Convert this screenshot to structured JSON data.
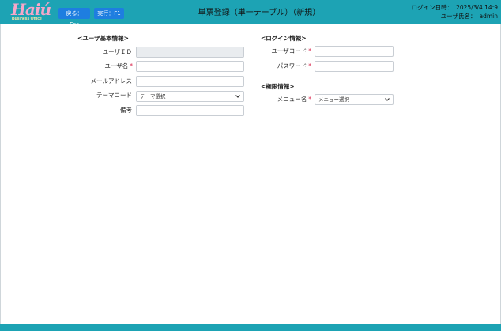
{
  "header": {
    "logo_main": "Haiú",
    "logo_sub": "Business Office",
    "back_button": "戻る：Esc",
    "run_button": "実行：F1",
    "title": "単票登録（単一テーブル）（新規）",
    "login_time_label": "ログイン日時：",
    "login_time_value": "2025/3/4 14:9",
    "user_name_label": "ユーザ氏名：",
    "user_name_value": "admin"
  },
  "user_info": {
    "section_title": "<ユーザ基本情報>",
    "user_id_label": "ユーザＩＤ",
    "user_name_label": "ユーザ名",
    "email_label": "メールアドレス",
    "theme_label": "テーマコード",
    "theme_selected": "テーマ選択",
    "note_label": "備考"
  },
  "login_info": {
    "section_title": "<ログイン情報>",
    "user_code_label": "ユーザコード",
    "password_label": "パスワード"
  },
  "permission": {
    "section_title": "<権限情報>",
    "menu_label": "メニュー名",
    "menu_selected": "メニュー選択"
  },
  "required_mark": "*",
  "colors": {
    "header": "#1da3b4",
    "button": "#1e7ee0",
    "required": "#d9224a"
  }
}
